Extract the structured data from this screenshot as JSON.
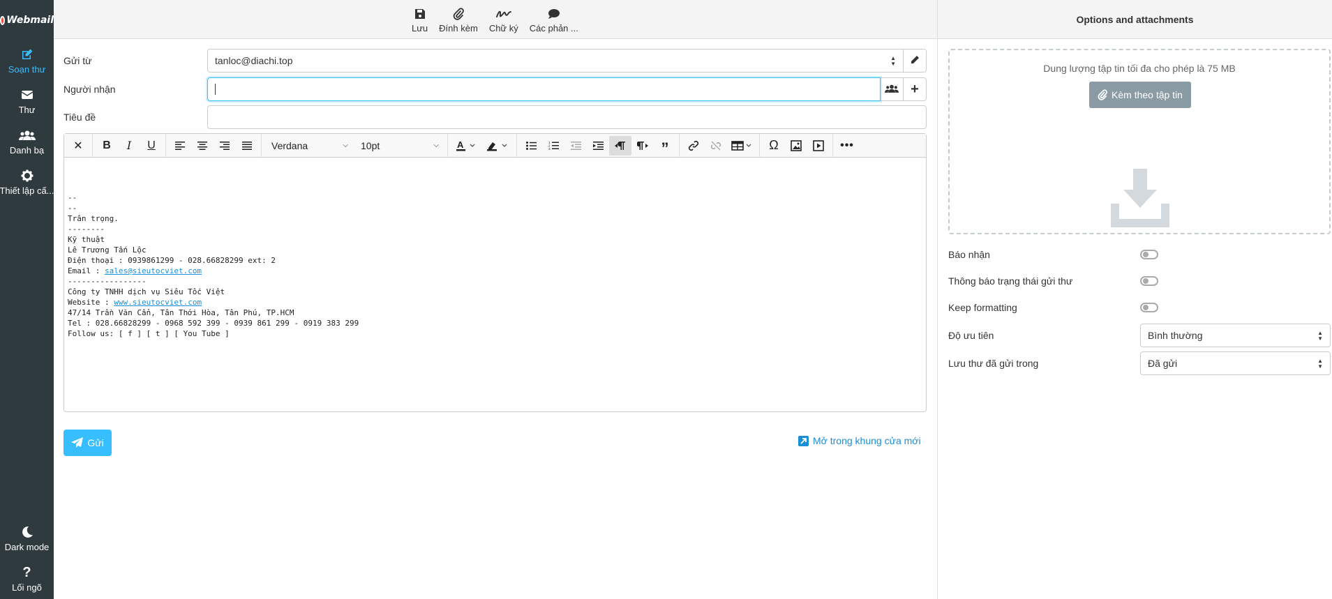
{
  "app": {
    "logo_text": "Webmail"
  },
  "nav": {
    "items": [
      {
        "label": "Soạn thư",
        "icon": "compose-icon",
        "active": true
      },
      {
        "label": "Thư",
        "icon": "envelope-icon"
      },
      {
        "label": "Danh bạ",
        "icon": "users-icon"
      },
      {
        "label": "Thiết lập cấ...",
        "icon": "gear-icon"
      }
    ],
    "bottom": [
      {
        "label": "Dark mode",
        "icon": "moon-icon"
      },
      {
        "label": "Lối ngõ",
        "icon": "question-icon"
      }
    ]
  },
  "toolbar": {
    "save": "Lưu",
    "attach": "Đính kèm",
    "signature": "Chữ ký",
    "responses": "Các phản ..."
  },
  "compose": {
    "from_label": "Gửi từ",
    "from_value": "tanloc@diachi.top",
    "to_label": "Người nhận",
    "to_value": "",
    "subject_label": "Tiêu đề",
    "subject_value": ""
  },
  "editor": {
    "font": "Verdana",
    "size": "10pt",
    "body_lines": [
      "--",
      "--",
      "Trân trọng.",
      "--------",
      "Kỹ thuật",
      "Lê Trương Tấn Lộc",
      "Điện thoại : 0939861299 - 028.66828299 ext: 2"
    ],
    "email_prefix": "Email : ",
    "email_link": "sales@sieutocviet.com",
    "body_lines2": [
      "-----------------",
      "Công ty TNHH dịch vụ Siêu Tốc Việt"
    ],
    "website_prefix": "Website : ",
    "website_link": "www.sieutocviet.com",
    "body_lines3": [
      "47/14 Trần Văn Cẩn, Tân Thới Hòa, Tân Phú, TP.HCM",
      "Tel : 028.66828299 - 0968 592 399 - 0939 861 299 - 0919 383 299",
      "Follow us: [ f ] [ t ] [ You Tube ]"
    ]
  },
  "actions": {
    "send": "Gửi",
    "open_new": "Mở trong khung cửa mới"
  },
  "right_panel": {
    "title": "Options and attachments",
    "max_size_text": "Dung lượng tập tin tối đa cho phép là 75 MB",
    "attach_button": "Kèm theo tập tin",
    "options": {
      "receipt": "Báo nhận",
      "dsn": "Thông báo trạng thái gửi thư",
      "keep_formatting": "Keep formatting",
      "priority_label": "Độ ưu tiên",
      "priority_value": "Bình thường",
      "sent_folder_label": "Lưu thư đã gửi trong",
      "sent_folder_value": "Đã gửi"
    }
  },
  "colors": {
    "accent": "#37beff",
    "nav_bg": "#2f3a3f",
    "link": "#1a8fd6"
  }
}
